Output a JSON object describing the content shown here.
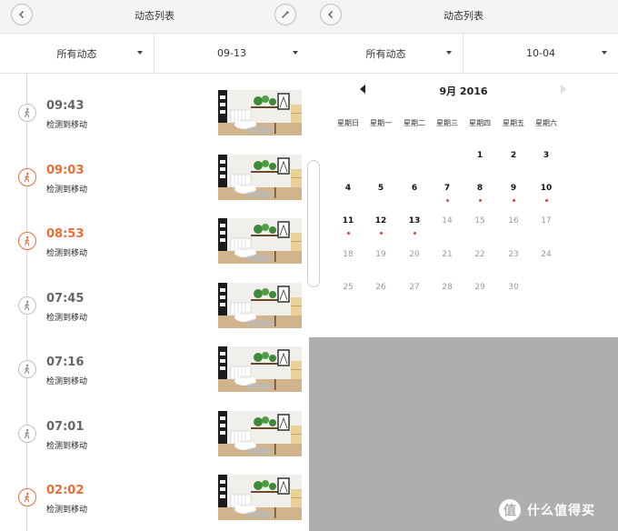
{
  "left": {
    "title": "动态列表",
    "filter_type": "所有动态",
    "filter_date": "09-13",
    "events": [
      {
        "time": "09:43",
        "desc": "检测到移动",
        "alert": false
      },
      {
        "time": "09:03",
        "desc": "检测到移动",
        "alert": true
      },
      {
        "time": "08:53",
        "desc": "检测到移动",
        "alert": true
      },
      {
        "time": "07:45",
        "desc": "检测到移动",
        "alert": false
      },
      {
        "time": "07:16",
        "desc": "检测到移动",
        "alert": false
      },
      {
        "time": "07:01",
        "desc": "检测到移动",
        "alert": false
      },
      {
        "time": "02:02",
        "desc": "检测到移动",
        "alert": true
      }
    ]
  },
  "right": {
    "title": "动态列表",
    "filter_type": "所有动态",
    "filter_date": "10-04",
    "calendar": {
      "month_label": "9月 2016",
      "weekdays": [
        "星期日",
        "星期一",
        "星期二",
        "星期三",
        "星期四",
        "星期五",
        "星期六"
      ],
      "first_weekday": 4,
      "days_in_month": 30,
      "active_days": [
        1,
        2,
        3,
        4,
        5,
        6,
        7,
        8,
        9,
        10,
        11,
        12,
        13
      ],
      "recorded_days": [
        7,
        8,
        9,
        10,
        11,
        12,
        13
      ]
    }
  },
  "watermark": {
    "text": "什么值得买"
  },
  "colors": {
    "accent": "#f06a35",
    "record_dot": "#e83f3f",
    "overlay": "#aeaeae",
    "titlebar": "#f4f4f4"
  },
  "icons": {
    "back": "back-arrow-icon",
    "edit": "pencil-icon",
    "event": "walking-person-icon"
  }
}
